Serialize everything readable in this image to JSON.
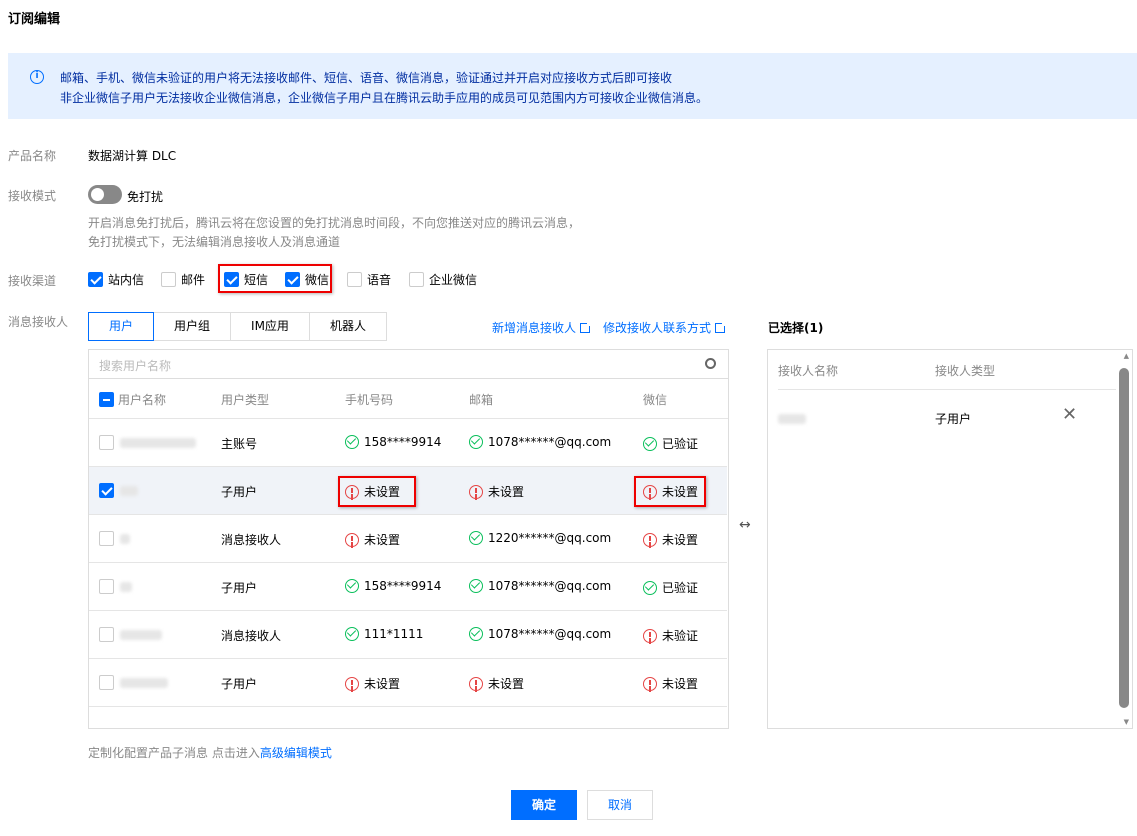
{
  "title": "订阅编辑",
  "notice": {
    "line1": "邮箱、手机、微信未验证的用户将无法接收邮件、短信、语音、微信消息，验证通过并开启对应接收方式后即可接收",
    "line2": "非企业微信子用户无法接收企业微信消息，企业微信子用户且在腾讯云助手应用的成员可见范围内方可接收企业微信消息。"
  },
  "product": {
    "label": "产品名称",
    "value": "数据湖计算 DLC"
  },
  "mode": {
    "label": "接收模式",
    "toggle_label": "免打扰",
    "help1": "开启消息免打扰后，腾讯云将在您设置的免打扰消息时间段，不向您推送对应的腾讯云消息，",
    "help2": "免打扰模式下，无法编辑消息接收人及消息通道"
  },
  "channels": {
    "label": "接收渠道",
    "items": [
      {
        "label": "站内信",
        "checked": true
      },
      {
        "label": "邮件",
        "checked": false
      },
      {
        "label": "短信",
        "checked": true
      },
      {
        "label": "微信",
        "checked": true
      },
      {
        "label": "语音",
        "checked": false
      },
      {
        "label": "企业微信",
        "checked": false
      }
    ]
  },
  "recipients": {
    "label": "消息接收人",
    "tabs": [
      "用户",
      "用户组",
      "IM应用",
      "机器人"
    ],
    "link_add": "新增消息接收人",
    "link_edit": "修改接收人联系方式",
    "search_placeholder": "搜索用户名称",
    "columns": [
      "用户名称",
      "用户类型",
      "手机号码",
      "邮箱",
      "微信"
    ],
    "rows": [
      {
        "checked": false,
        "type": "主账号",
        "phone": "158****9914",
        "phone_ok": true,
        "email": "1078******@qq.com",
        "email_ok": true,
        "wechat": "已验证",
        "wechat_ok": true
      },
      {
        "checked": true,
        "type": "子用户",
        "phone": "未设置",
        "phone_ok": false,
        "email": "未设置",
        "email_ok": false,
        "wechat": "未设置",
        "wechat_ok": false
      },
      {
        "checked": false,
        "type": "消息接收人",
        "phone": "未设置",
        "phone_ok": false,
        "email": "1220******@qq.com",
        "email_ok": true,
        "wechat": "未设置",
        "wechat_ok": false
      },
      {
        "checked": false,
        "type": "子用户",
        "phone": "158****9914",
        "phone_ok": true,
        "email": "1078******@qq.com",
        "email_ok": true,
        "wechat": "已验证",
        "wechat_ok": true
      },
      {
        "checked": false,
        "type": "消息接收人",
        "phone": "111*1111",
        "phone_ok": true,
        "email": "1078******@qq.com",
        "email_ok": true,
        "wechat": "未验证",
        "wechat_ok": false
      },
      {
        "checked": false,
        "type": "子用户",
        "phone": "未设置",
        "phone_ok": false,
        "email": "未设置",
        "email_ok": false,
        "wechat": "未设置",
        "wechat_ok": false
      }
    ]
  },
  "selected": {
    "title": "已选择(1)",
    "columns": [
      "接收人名称",
      "接收人类型"
    ],
    "rows": [
      {
        "type": "子用户"
      }
    ]
  },
  "footer": {
    "custom_text": "定制化配置产品子消息 点击进入",
    "custom_link": "高级编辑模式",
    "confirm": "确定",
    "cancel": "取消"
  },
  "colors": {
    "primary": "#006eff",
    "success": "#0abf5b",
    "danger": "#e54545",
    "notice_bg": "#e5f0ff"
  }
}
